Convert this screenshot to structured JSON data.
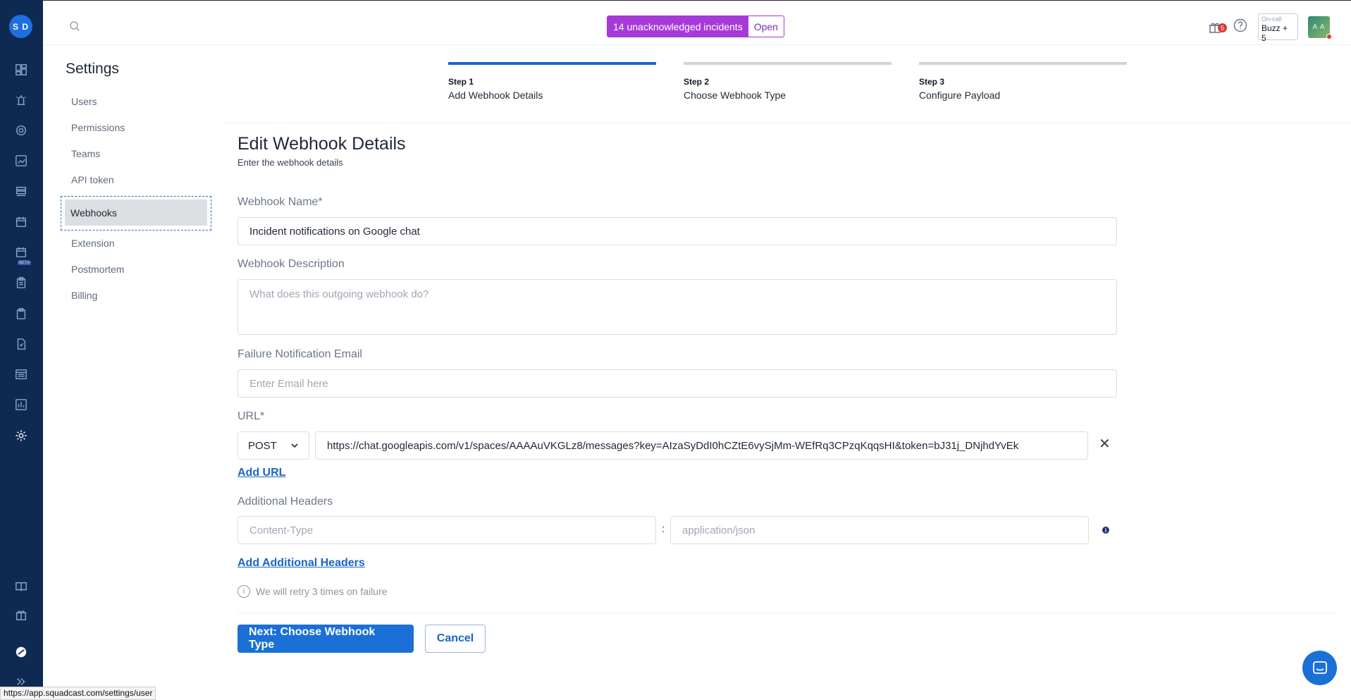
{
  "rail": {
    "avatar_initials": "S D",
    "beta_label": "BETA"
  },
  "topbar": {
    "incidents_label": "14 unacknowledged incidents",
    "open_label": "Open",
    "notifications_count": "5",
    "oncall_label": "On-call",
    "oncall_value": "Buzz + 5",
    "user_initials": "A A"
  },
  "settings": {
    "title": "Settings",
    "items": [
      {
        "label": "Users"
      },
      {
        "label": "Permissions"
      },
      {
        "label": "Teams"
      },
      {
        "label": "API token"
      },
      {
        "label": "Webhooks"
      },
      {
        "label": "Extension"
      },
      {
        "label": "Postmortem"
      },
      {
        "label": "Billing"
      }
    ],
    "active_index": 4
  },
  "stepper": {
    "steps": [
      {
        "num": "Step 1",
        "label": "Add Webhook Details",
        "active": true
      },
      {
        "num": "Step 2",
        "label": "Choose Webhook Type",
        "active": false
      },
      {
        "num": "Step 3",
        "label": "Configure Payload",
        "active": false
      }
    ]
  },
  "form": {
    "title": "Edit Webhook Details",
    "subtitle": "Enter the webhook details",
    "name_label": "Webhook Name*",
    "name_value": "Incident notifications on Google chat",
    "description_label": "Webhook Description",
    "description_placeholder": "What does this outgoing webhook do?",
    "email_label": "Failure Notification Email",
    "email_placeholder": "Enter Email here",
    "url_label": "URL*",
    "method_value": "POST",
    "url_value": "https://chat.googleapis.com/v1/spaces/AAAAuVKGLz8/messages?key=AIzaSyDdI0hCZtE6vySjMm-WEfRq3CPzqKqqsHI&token=bJ31j_DNjhdYvEk",
    "add_url_label": "Add URL",
    "headers_label": "Additional Headers",
    "header_key_placeholder": "Content-Type",
    "header_separator": ":",
    "header_value_placeholder": "application/json",
    "add_headers_label": "Add Additional Headers",
    "retry_note": "We will retry 3 times on failure",
    "next_button": "Next: Choose Webhook Type",
    "cancel_button": "Cancel"
  },
  "status_bar_url": "https://app.squadcast.com/settings/user",
  "colors": {
    "rail_bg": "#0f2a52",
    "accent": "#1a70d7",
    "incident_purple": "#a63ad9"
  }
}
